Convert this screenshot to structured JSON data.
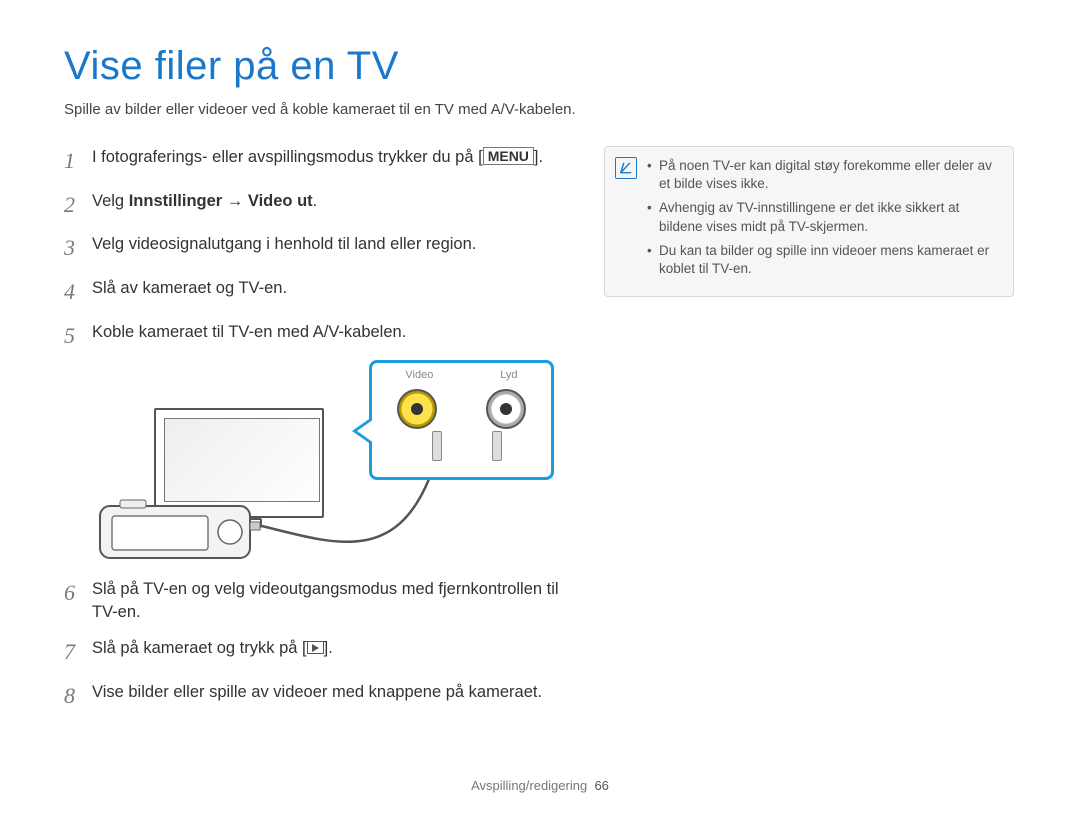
{
  "title": "Vise filer på en TV",
  "subtitle": "Spille av bilder eller videoer ved å koble kameraet til en TV med A/V-kabelen.",
  "steps": {
    "s1": {
      "num": "1",
      "pre": "I fotograferings- eller avspillingsmodus trykker du på [",
      "menu": "MENU",
      "post": "]."
    },
    "s2": {
      "num": "2",
      "pre": "Velg ",
      "bold": "Innstillinger → Video ut",
      "post": "."
    },
    "s3": {
      "num": "3",
      "text": "Velg videosignalutgang i henhold til land eller region."
    },
    "s4": {
      "num": "4",
      "text": "Slå av kameraet og TV-en."
    },
    "s5": {
      "num": "5",
      "text": "Koble kameraet til TV-en med A/V-kabelen."
    },
    "s6": {
      "num": "6",
      "text": "Slå på TV-en og velg videoutgangsmodus med fjernkontrollen til TV-en."
    },
    "s7": {
      "num": "7",
      "pre": "Slå på kameraet og trykk på [",
      "post": "]."
    },
    "s8": {
      "num": "8",
      "text": "Vise bilder eller spille av videoer med knappene på kameraet."
    }
  },
  "diagram": {
    "video_label": "Video",
    "audio_label": "Lyd"
  },
  "notes": {
    "n1": "På noen TV-er kan digital støy forekomme eller deler av et bilde vises ikke.",
    "n2": "Avhengig av TV-innstillingene er det ikke sikkert at bildene vises midt på TV-skjermen.",
    "n3": "Du kan ta bilder og spille inn videoer mens kameraet er koblet til TV-en."
  },
  "footer": {
    "section": "Avspilling/redigering",
    "page": "66"
  }
}
